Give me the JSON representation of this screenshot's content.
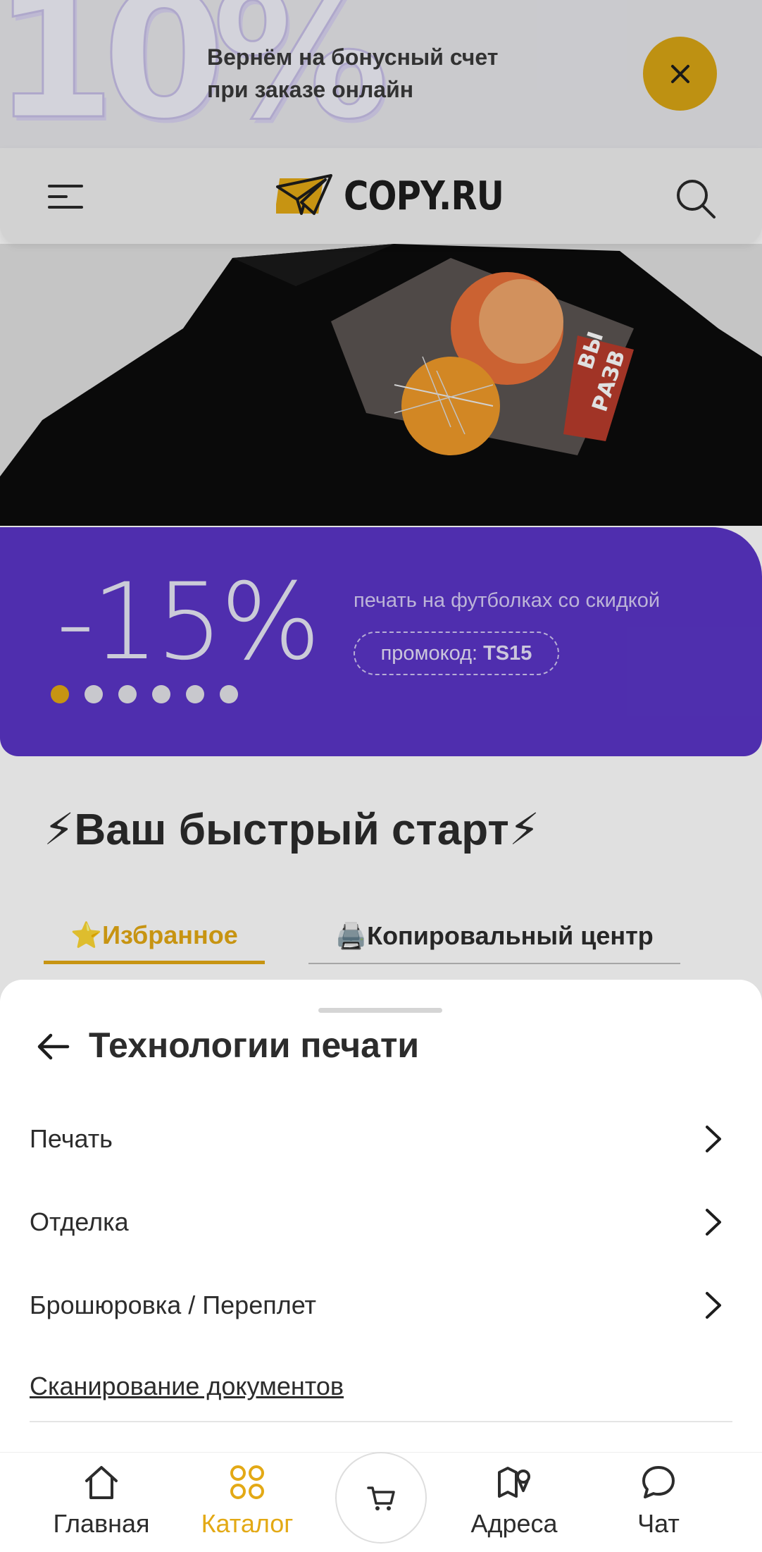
{
  "promo": {
    "big_text": "10%",
    "line1": "Вернём на бонусный счет",
    "line2": "при заказе онлайн"
  },
  "header": {
    "logo_text": "COPY.RU"
  },
  "banner": {
    "discount": "-15%",
    "caption": "печать на футболках со скидкой",
    "code_label": "промокод:",
    "code_value": "TS15",
    "slides_count": 6,
    "active_slide": 1
  },
  "quick_start": {
    "title": "⚡Ваш быстрый старт⚡",
    "tabs": [
      {
        "label": "⭐Избранное",
        "active": true
      },
      {
        "label": "🖨️Копировальный центр",
        "active": false
      }
    ]
  },
  "sheet": {
    "title": "Технологии печати",
    "items": [
      {
        "label": "Печать"
      },
      {
        "label": "Отделка"
      },
      {
        "label": "Брошюровка / Переплет"
      }
    ],
    "link": "Сканирование документов"
  },
  "nav": {
    "items": [
      {
        "label": "Главная",
        "icon": "home-icon",
        "active": false
      },
      {
        "label": "Каталог",
        "icon": "catalog-icon",
        "active": true
      },
      {
        "label": "Адреса",
        "icon": "map-icon",
        "active": false
      },
      {
        "label": "Чат",
        "icon": "chat-icon",
        "active": false
      }
    ],
    "cart_icon": "cart-icon"
  },
  "colors": {
    "accent": "#e3a915",
    "banner_purple": "#5a35c6",
    "text": "#2c2c2c"
  }
}
